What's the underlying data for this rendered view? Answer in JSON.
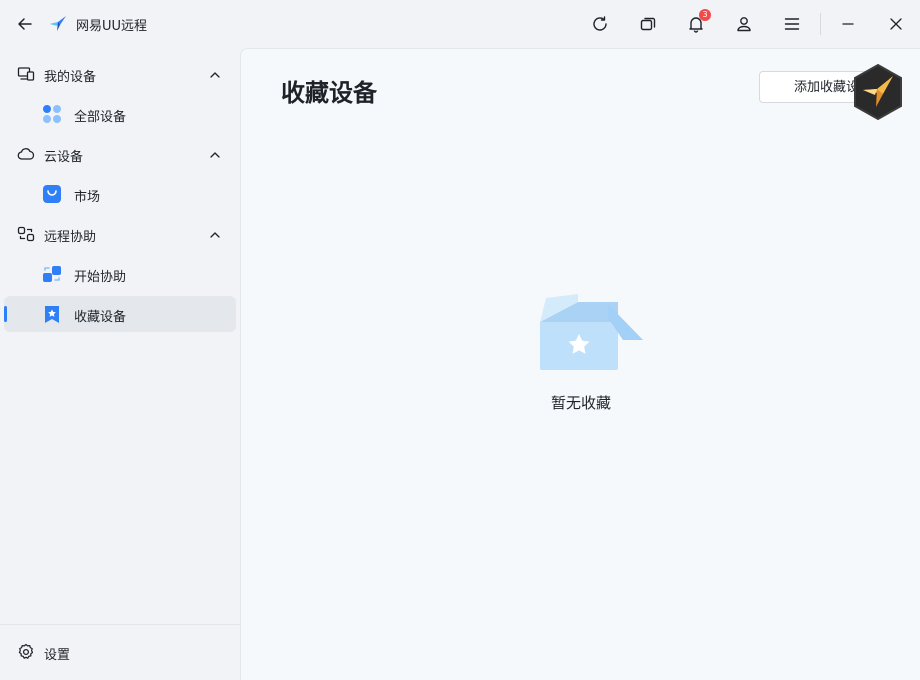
{
  "app": {
    "title": "网易UU远程",
    "notification_count": "3"
  },
  "sidebar": {
    "groups": [
      {
        "label": "我的设备",
        "items": [
          {
            "label": "全部设备"
          }
        ]
      },
      {
        "label": "云设备",
        "items": [
          {
            "label": "市场"
          }
        ]
      },
      {
        "label": "远程协助",
        "items": [
          {
            "label": "开始协助"
          },
          {
            "label": "收藏设备"
          }
        ]
      }
    ],
    "settings_label": "设置"
  },
  "main": {
    "title": "收藏设备",
    "add_button": "添加收藏设备",
    "empty_text": "暂无收藏"
  },
  "colors": {
    "accent": "#2f7ff7",
    "badge": "#f24a4a"
  }
}
